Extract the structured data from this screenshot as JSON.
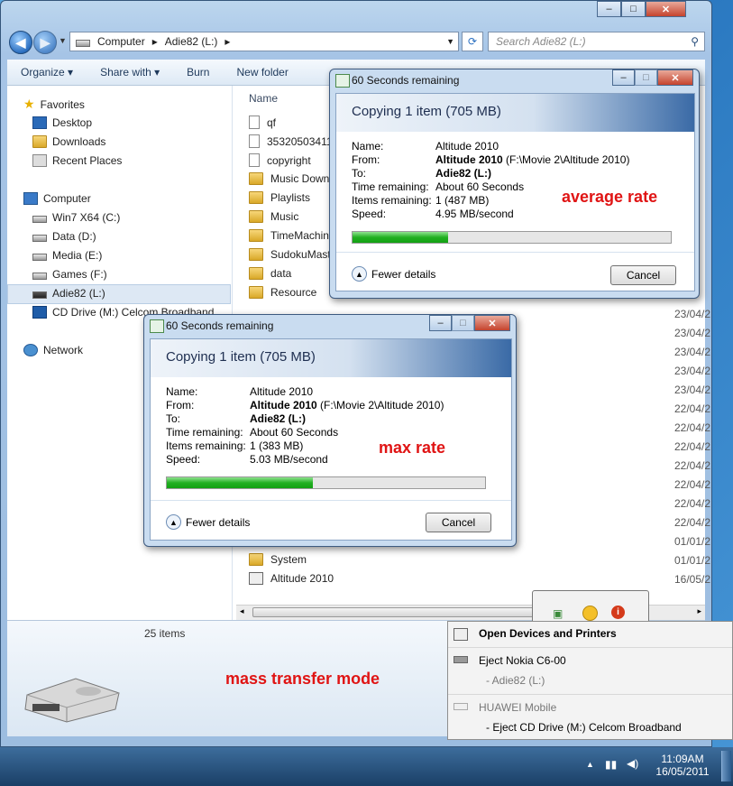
{
  "explorer": {
    "address": {
      "root": "Computer",
      "drive": "Adie82 (L:)"
    },
    "search_placeholder": "Search Adie82 (L:)",
    "toolbar": {
      "organize": "Organize",
      "share_with": "Share with",
      "burn": "Burn",
      "new_folder": "New folder"
    },
    "nav": {
      "favorites": "Favorites",
      "fav_items": [
        "Desktop",
        "Downloads",
        "Recent Places"
      ],
      "computer": "Computer",
      "drives": [
        "Win7 X64 (C:)",
        "Data (D:)",
        "Media (E:)",
        "Games (F:)",
        "Adie82 (L:)",
        "CD Drive (M:) Celcom Broadband"
      ],
      "network": "Network"
    },
    "column_name": "Name",
    "files": [
      {
        "name": "qf",
        "date": ""
      },
      {
        "name": "35320503411",
        "date": ""
      },
      {
        "name": "copyright",
        "date": ""
      },
      {
        "name": "Music Downl",
        "date": ""
      },
      {
        "name": "Playlists",
        "date": ""
      },
      {
        "name": "Music",
        "date": ""
      },
      {
        "name": "TimeMachin",
        "date": ""
      },
      {
        "name": "SudokuMaste",
        "date": ""
      },
      {
        "name": "data",
        "date": ""
      },
      {
        "name": "Resource",
        "date": ""
      },
      {
        "name": "System",
        "date": "01/01/2"
      },
      {
        "name": "Altitude 2010",
        "date": "16/05/2"
      }
    ],
    "hidden_dates": [
      "23/04/2",
      "23/04/2",
      "23/04/2",
      "23/04/2",
      "23/04/2",
      "22/04/2",
      "22/04/2",
      "22/04/2",
      "22/04/2",
      "22/04/2",
      "22/04/2",
      "22/04/2",
      "01/01/2"
    ],
    "item_count": "25 items"
  },
  "copy_dialog_avg": {
    "title": "60 Seconds remaining",
    "header": "Copying 1 item (705 MB)",
    "name_label": "Name:",
    "name": "Altitude 2010",
    "from_label": "From:",
    "from_bold": "Altitude 2010",
    "from_path": "(F:\\Movie 2\\Altitude 2010)",
    "to_label": "To:",
    "to": "Adie82 (L:)",
    "time_label": "Time remaining:",
    "time": "About 60 Seconds",
    "items_label": "Items remaining:",
    "items": "1 (487 MB)",
    "speed_label": "Speed:",
    "speed": "4.95 MB/second",
    "progress": 0.3,
    "fewer": "Fewer details",
    "cancel": "Cancel"
  },
  "copy_dialog_max": {
    "title": "60 Seconds remaining",
    "header": "Copying 1 item (705 MB)",
    "name_label": "Name:",
    "name": "Altitude 2010",
    "from_label": "From:",
    "from_bold": "Altitude 2010",
    "from_path": "(F:\\Movie 2\\Altitude 2010)",
    "to_label": "To:",
    "to": "Adie82 (L:)",
    "time_label": "Time remaining:",
    "time": "About 60 Seconds",
    "items_label": "Items remaining:",
    "items": "1 (383 MB)",
    "speed_label": "Speed:",
    "speed": "5.03 MB/second",
    "progress": 0.46,
    "fewer": "Fewer details",
    "cancel": "Cancel"
  },
  "annotations": {
    "average": "average rate",
    "max": "max rate",
    "mass": "mass transfer mode"
  },
  "tray_menu": {
    "open_devices": "Open Devices and Printers",
    "eject_nokia": "Eject Nokia C6-00",
    "nokia_sub": "- Adie82 (L:)",
    "huawei": "HUAWEI Mobile",
    "eject_cd": "- Eject CD Drive (M:) Celcom Broadband"
  },
  "clock": {
    "time": "11:09AM",
    "date": "16/05/2011"
  },
  "colors": {
    "accent_red": "#e01414",
    "progress_green": "#22b022"
  }
}
